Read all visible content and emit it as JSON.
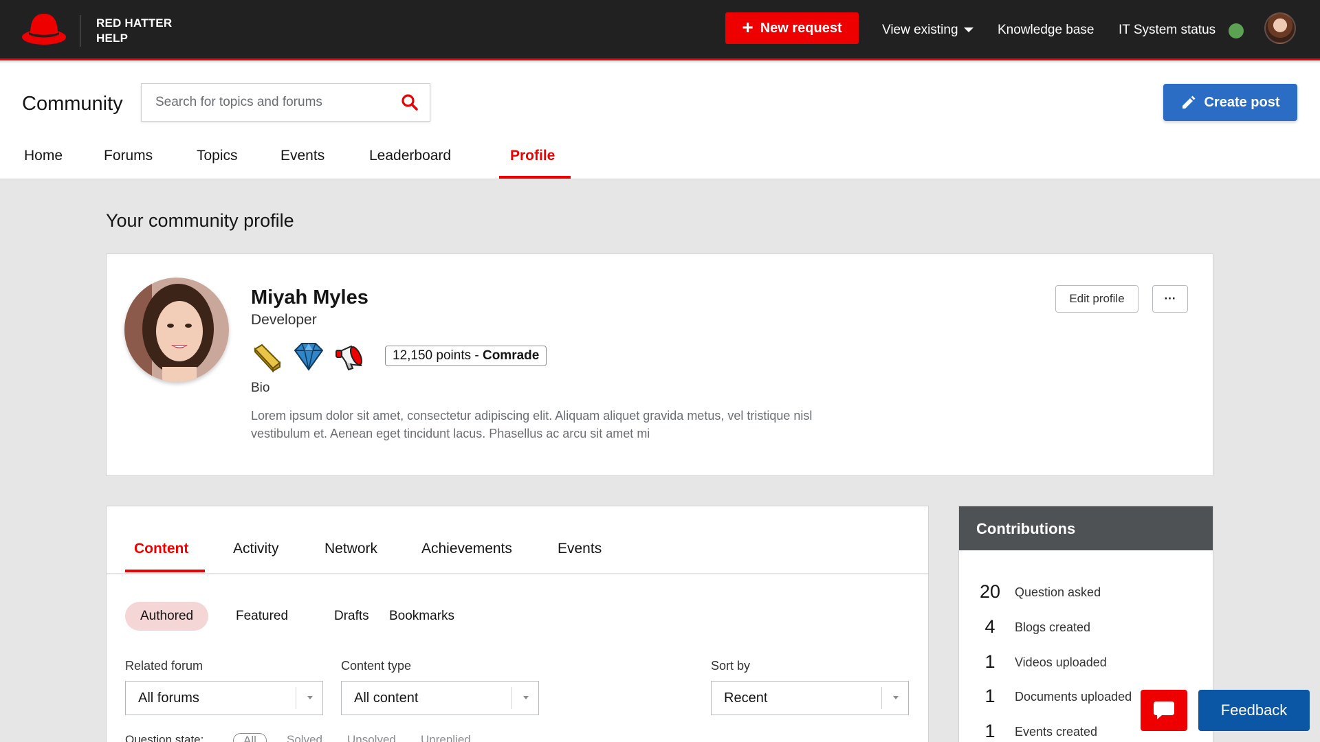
{
  "header": {
    "brand_line1": "RED HATTER",
    "brand_line2": "HELP",
    "new_request": "New request",
    "view_existing": "View existing",
    "knowledge_base": "Knowledge base",
    "it_status": "IT System status",
    "status_color": "#5ba352"
  },
  "subheader": {
    "title": "Community",
    "search_placeholder": "Search for topics and forums",
    "create_post": "Create post"
  },
  "tabs": [
    "Home",
    "Forums",
    "Topics",
    "Events",
    "Leaderboard",
    "Profile"
  ],
  "active_tab": "Profile",
  "page_title": "Your community profile",
  "profile": {
    "name": "Miyah Myles",
    "role": "Developer",
    "points": "12,150 points",
    "points_sep": " - ",
    "rank": "Comrade",
    "bio_label": "Bio",
    "bio": "Lorem ipsum dolor sit amet, consectetur adipiscing elit. Aliquam aliquet gravida metus, vel tristique nisl vestibulum et. Aenean eget tincidunt lacus. Phasellus ac arcu sit amet mi",
    "edit_profile": "Edit profile",
    "more": "···",
    "badges": [
      "gold-bar-icon",
      "diamond-icon",
      "megaphone-icon"
    ]
  },
  "content": {
    "tabs": [
      "Content",
      "Activity",
      "Network",
      "Achievements",
      "Events"
    ],
    "pills": [
      "Authored",
      "Featured",
      "Drafts",
      "Bookmarks"
    ],
    "filters": {
      "forum_label": "Related forum",
      "forum_value": "All forums",
      "type_label": "Content type",
      "type_value": "All content",
      "sort_label": "Sort by",
      "sort_value": "Recent"
    },
    "question_state": {
      "label": "Question state:",
      "options": [
        "All",
        "Solved",
        "Unsolved",
        "Unreplied"
      ]
    }
  },
  "contributions": {
    "title": "Contributions",
    "rows": [
      {
        "num": "20",
        "label": "Question asked"
      },
      {
        "num": "4",
        "label": "Blogs created"
      },
      {
        "num": "1",
        "label": "Videos uploaded"
      },
      {
        "num": "1",
        "label": "Documents uploaded"
      },
      {
        "num": "1",
        "label": "Events created"
      }
    ]
  },
  "feedback": "Feedback"
}
